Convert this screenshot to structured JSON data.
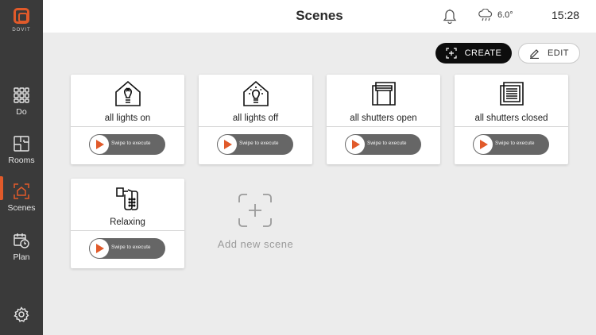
{
  "sidebar": {
    "brand_name": "DOVIT",
    "items": [
      {
        "label": "Do",
        "icon": "grid-icon"
      },
      {
        "label": "Rooms",
        "icon": "floorplan-icon"
      },
      {
        "label": "Scenes",
        "icon": "scene-icon",
        "active": true
      },
      {
        "label": "Plan",
        "icon": "calendar-clock-icon"
      }
    ],
    "settings_icon": "gear-icon"
  },
  "header": {
    "title": "Scenes",
    "notification_icon": "bell-icon",
    "weather_icon": "cloud-rain-icon",
    "temperature": "6.0°",
    "time": "15:28"
  },
  "toolbar": {
    "create_label": "CREATE",
    "edit_label": "EDIT"
  },
  "scenes": [
    {
      "title": "all lights on",
      "icon": "house-bulb-off-icon",
      "action": "Swipe to execute"
    },
    {
      "title": "all lights off",
      "icon": "house-bulb-on-icon",
      "action": "Swipe to execute"
    },
    {
      "title": "all shutters open",
      "icon": "shutter-open-icon",
      "action": "Swipe to execute"
    },
    {
      "title": "all shutters closed",
      "icon": "shutter-closed-icon",
      "action": "Swipe to execute"
    },
    {
      "title": "Relaxing",
      "icon": "device-plug-icon",
      "action": "Swipe to execute"
    }
  ],
  "add_scene": {
    "label": "Add new scene",
    "icon": "add-frame-icon"
  },
  "colors": {
    "accent": "#e15a2a",
    "sidebar": "#3a3a3a",
    "background": "#ececec",
    "swipe_track": "#666666"
  }
}
